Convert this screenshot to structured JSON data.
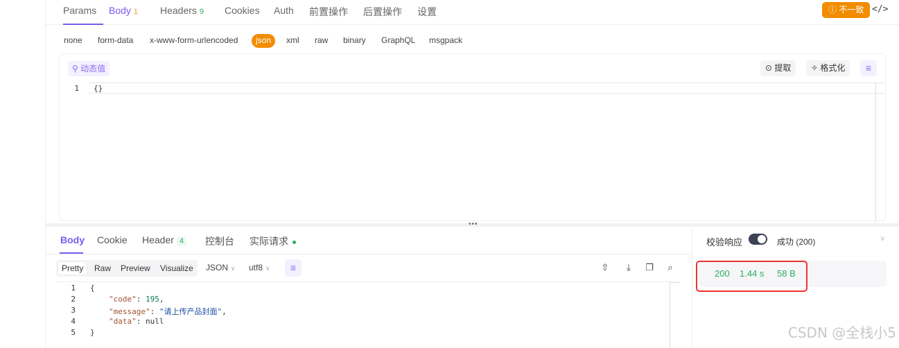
{
  "request_tabs": [
    {
      "label": "Params"
    },
    {
      "label": "Body",
      "badge": "1"
    },
    {
      "label": "Headers",
      "badge": "9"
    },
    {
      "label": "Cookies"
    },
    {
      "label": "Auth"
    },
    {
      "label": "前置操作"
    },
    {
      "label": "后置操作"
    },
    {
      "label": "设置"
    }
  ],
  "inconsistent_label": "不一致",
  "code_toggle": "</>",
  "body_types": [
    "none",
    "form-data",
    "x-www-form-urlencoded",
    "json",
    "xml",
    "raw",
    "binary",
    "GraphQL",
    "msgpack"
  ],
  "editor": {
    "dynamic_value": "动态值",
    "extract": "提取",
    "format": "格式化",
    "line_numbers": [
      "1"
    ],
    "content": "{}"
  },
  "response_tabs": [
    {
      "label": "Body"
    },
    {
      "label": "Cookie"
    },
    {
      "label": "Header",
      "badge": "4"
    },
    {
      "label": "控制台"
    },
    {
      "label": "实际请求"
    }
  ],
  "view_modes": [
    "Pretty",
    "Raw",
    "Preview",
    "Visualize"
  ],
  "format_select": "JSON",
  "encoding_select": "utf8",
  "response_lines": {
    "numbers": [
      "1",
      "2",
      "3",
      "4",
      "5"
    ],
    "l1": "{",
    "l2_key": "\"code\"",
    "l2_val": "195",
    "l3_key": "\"message\"",
    "l3_val": "\"请上传产品封面\"",
    "l4_key": "\"data\"",
    "l4_val": "null",
    "l5": "}"
  },
  "right_panel": {
    "verify_label": "校验响应",
    "success_label": "成功 (200)",
    "status_code": "200",
    "time": "1.44 s",
    "size": "58 B"
  },
  "watermark": "CSDN @全栈小5",
  "colors": {
    "accent": "#7a5af0",
    "orange": "#f28c00",
    "success": "#27ae60",
    "highlight": "#e33"
  }
}
